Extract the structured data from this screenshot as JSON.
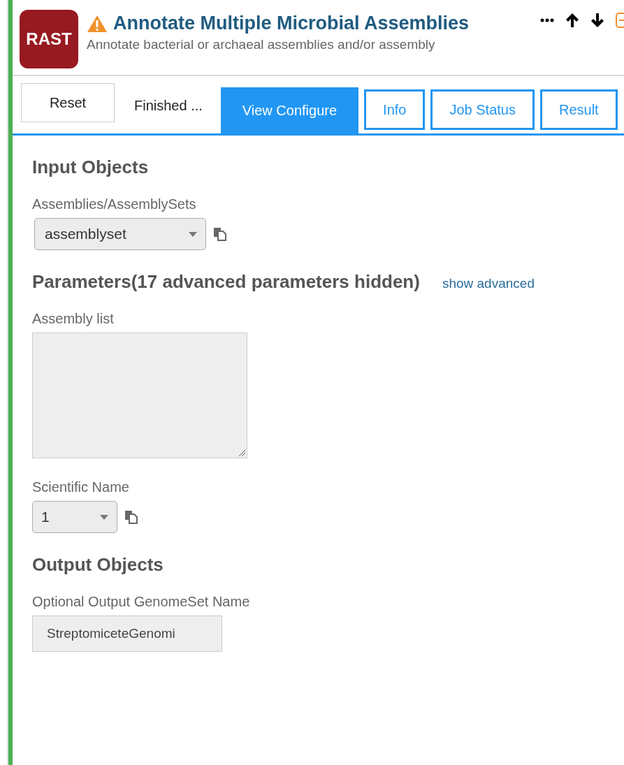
{
  "app": {
    "logo": "RAST",
    "warning": true,
    "title": "Annotate Multiple Microbial Assemblies",
    "subtitle": "Annotate bacterial or archaeal assemblies and/or assembly"
  },
  "toolbar": [
    {
      "kind": "more"
    },
    {
      "kind": "up"
    },
    {
      "kind": "down"
    },
    {
      "kind": "collapse"
    }
  ],
  "reset_button": "Reset",
  "status": "Finished ...",
  "tabs": [
    {
      "label": "View Configure",
      "selected": true
    },
    {
      "label": "Info",
      "selected": false
    },
    {
      "label": "Job Status",
      "selected": false
    },
    {
      "label": "Result",
      "selected": false
    }
  ],
  "sections": [
    {
      "title": "Input Objects",
      "fields": [
        {
          "kind": "select",
          "label": "Assemblies/AssemblySets",
          "value": "assemblyset",
          "copy": true
        }
      ]
    },
    {
      "title": "Parameters(17 advanced parameters hidden)",
      "link": "show advanced",
      "fields": [
        {
          "kind": "textarea",
          "label": "Assembly list"
        },
        {
          "kind": "select",
          "label": "Scientific Name",
          "value": "1",
          "copy": true,
          "narrow": true
        }
      ]
    },
    {
      "title": "Output Objects",
      "fields": [
        {
          "kind": "text",
          "label": "Optional Output GenomeSet Name",
          "value": "StreptomiceteGenomi"
        }
      ]
    }
  ]
}
